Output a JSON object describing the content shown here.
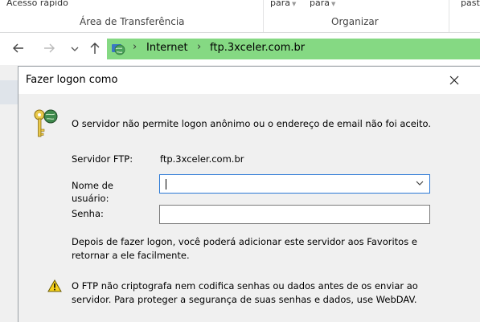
{
  "ribbon": {
    "quick_access": "Acesso rápido",
    "clipboard_group": "Área de Transferência",
    "move_to": "para",
    "copy_to": "para",
    "organize_group": "Organizar",
    "paste_partial": "past"
  },
  "nav": {
    "back_icon": "back-arrow-icon",
    "forward_icon": "forward-arrow-icon",
    "recent_icon": "chevron-down-icon",
    "up_icon": "up-arrow-icon"
  },
  "address": {
    "crumbs": [
      "Internet",
      "ftp.3xceler.com.br"
    ],
    "color": "#85d983"
  },
  "dialog": {
    "title": "Fazer logon como",
    "message": "O servidor não permite logon anônimo ou o endereço de email não foi aceito.",
    "server_label": "Servidor FTP:",
    "server_value": "ftp.3xceler.com.br",
    "username_label_1": "Nome de",
    "username_label_2": "usuário:",
    "username_value": "",
    "password_label": "Senha:",
    "password_value": "",
    "info_line1": "Depois de fazer logon, você poderá adicionar este servidor aos Favoritos e",
    "info_line2": "retornar a ele facilmente.",
    "warn_line1": "O FTP não criptografa nem codifica senhas ou dados antes de os enviar ao",
    "warn_line2": "servidor. Para proteger a segurança de suas senhas e dados, use WebDAV."
  }
}
